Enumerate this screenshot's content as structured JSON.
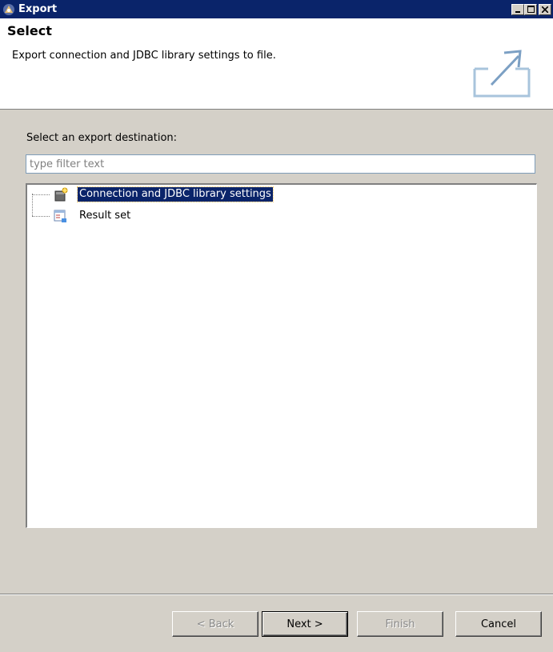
{
  "window": {
    "title": "Export",
    "controls": [
      "minimize",
      "maximize",
      "close"
    ]
  },
  "header": {
    "title": "Select",
    "description": "Export connection and JDBC library settings to file.",
    "graphic": "export-arrow-icon"
  },
  "destination": {
    "label": "Select an export destination:",
    "filter_placeholder": "type filter text",
    "filter_value": ""
  },
  "tree": {
    "items": [
      {
        "label": "Connection and JDBC library settings",
        "icon": "connection-settings-icon",
        "selected": true
      },
      {
        "label": "Result set",
        "icon": "result-set-icon",
        "selected": false
      }
    ]
  },
  "buttons": {
    "back": "< Back",
    "next": "Next >",
    "finish": "Finish",
    "cancel": "Cancel"
  },
  "colors": {
    "titlebar": "#0a246a",
    "selection": "#0a246a",
    "dialog_bg": "#d4d0c8"
  }
}
